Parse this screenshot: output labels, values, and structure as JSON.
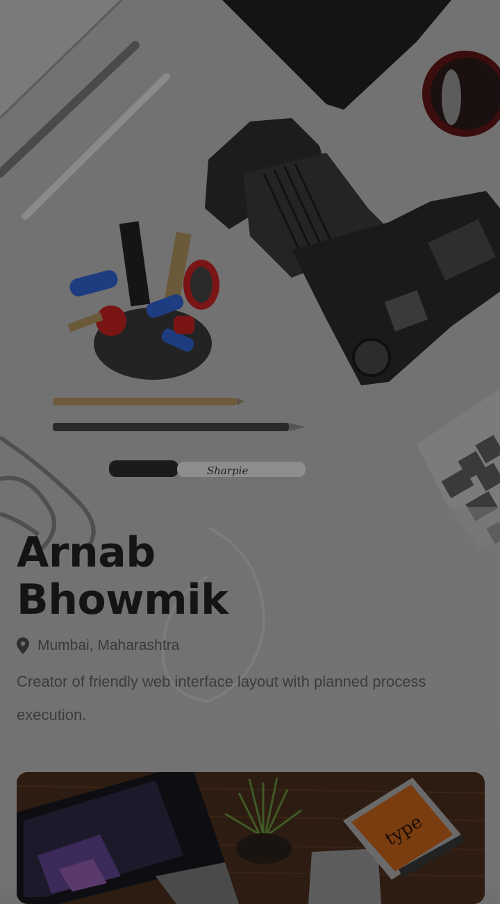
{
  "profile": {
    "first_name": "Arnab",
    "last_name": "Bhowmik",
    "location": "Mumbai, Maharashtra",
    "bio": "Creator of friendly web interface layout with planned process execution.",
    "location_icon": "map-pin-icon"
  },
  "cover_photo": {
    "brand_text": "Sharpie"
  },
  "portfolio_card": {
    "book_text": "type"
  },
  "colors": {
    "overlay": "#6f6f6f",
    "heading": "#141414",
    "body_text": "#3c3c3c"
  }
}
